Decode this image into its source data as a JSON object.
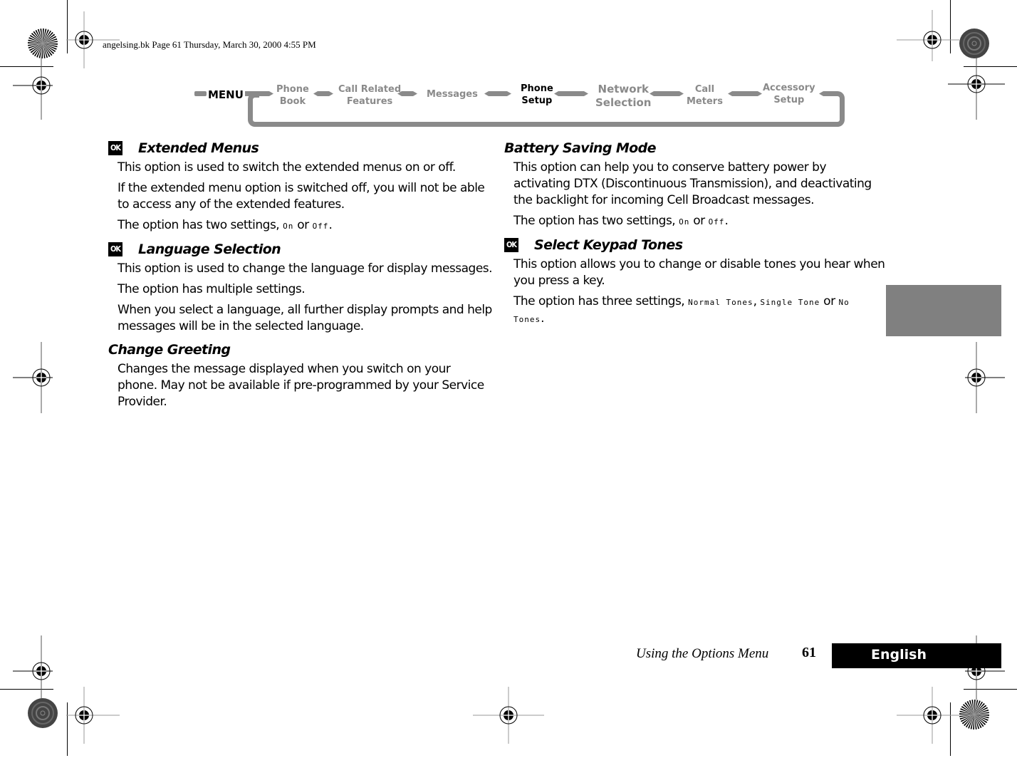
{
  "print_stamp": "angelsing.bk  Page 61  Thursday, March 30, 2000  4:55 PM",
  "menu": {
    "root": "MENU",
    "items": [
      {
        "line1": "Phone",
        "line2": "Book",
        "active": false
      },
      {
        "line1": "Call Related",
        "line2": "Features",
        "active": false
      },
      {
        "line1": "Messages",
        "line2": "",
        "active": false
      },
      {
        "line1": "Phone",
        "line2": "Setup",
        "active": true
      },
      {
        "line1": "Network",
        "line2": "Selection",
        "active": false
      },
      {
        "line1": "Call",
        "line2": "Meters",
        "active": false
      },
      {
        "line1": "Accessory",
        "line2": "Setup",
        "active": false
      }
    ]
  },
  "icons": {
    "ok": "OK"
  },
  "left_column": {
    "extended_menus": {
      "title": "Extended Menus",
      "p1": "This option is used to switch the extended menus on or off.",
      "p2": "If the extended menu option is switched off, you will not be able to access any of the extended features.",
      "p3_prefix": "The option has two settings, ",
      "opt_on": "On",
      "or": " or ",
      "opt_off": "Off",
      "end": "."
    },
    "language_selection": {
      "title": "Language Selection",
      "p1": "This option is used to change the language for display messages.",
      "p2": "The option has multiple settings.",
      "p3": "When you select a language, all further display prompts and help messages will be in the selected language."
    },
    "change_greeting": {
      "title": "Change Greeting",
      "p1": "Changes the message displayed when you switch on your phone. May not be available if pre-programmed by your Service Provider."
    }
  },
  "right_column": {
    "battery_saving": {
      "title": "Battery Saving Mode",
      "p1": "This option can help you to conserve battery power by activating DTX (Discontinuous Transmission), and deactivating the backlight for incoming Cell Broadcast messages.",
      "p2_prefix": "The option has two settings, ",
      "opt_on": "On",
      "or": " or ",
      "opt_off": "Off",
      "end": "."
    },
    "keypad_tones": {
      "title": "Select Keypad Tones",
      "p1": "This option allows you to change or disable tones you hear when you press a key.",
      "p2_prefix": "The option has three settings, ",
      "opt1": "Normal Tones",
      "sep": ", ",
      "opt2": "Single Tone",
      "or": " or ",
      "opt3": "No Tones",
      "end": "."
    }
  },
  "footer": {
    "chapter": "Using the Options Menu",
    "page": "61",
    "language_tab": "English"
  },
  "colors": {
    "menu_inactive": "#8a8a8a",
    "menu_track": "#8a8a8a",
    "side_tab": "#808080",
    "language_tab_bg": "#000000"
  }
}
